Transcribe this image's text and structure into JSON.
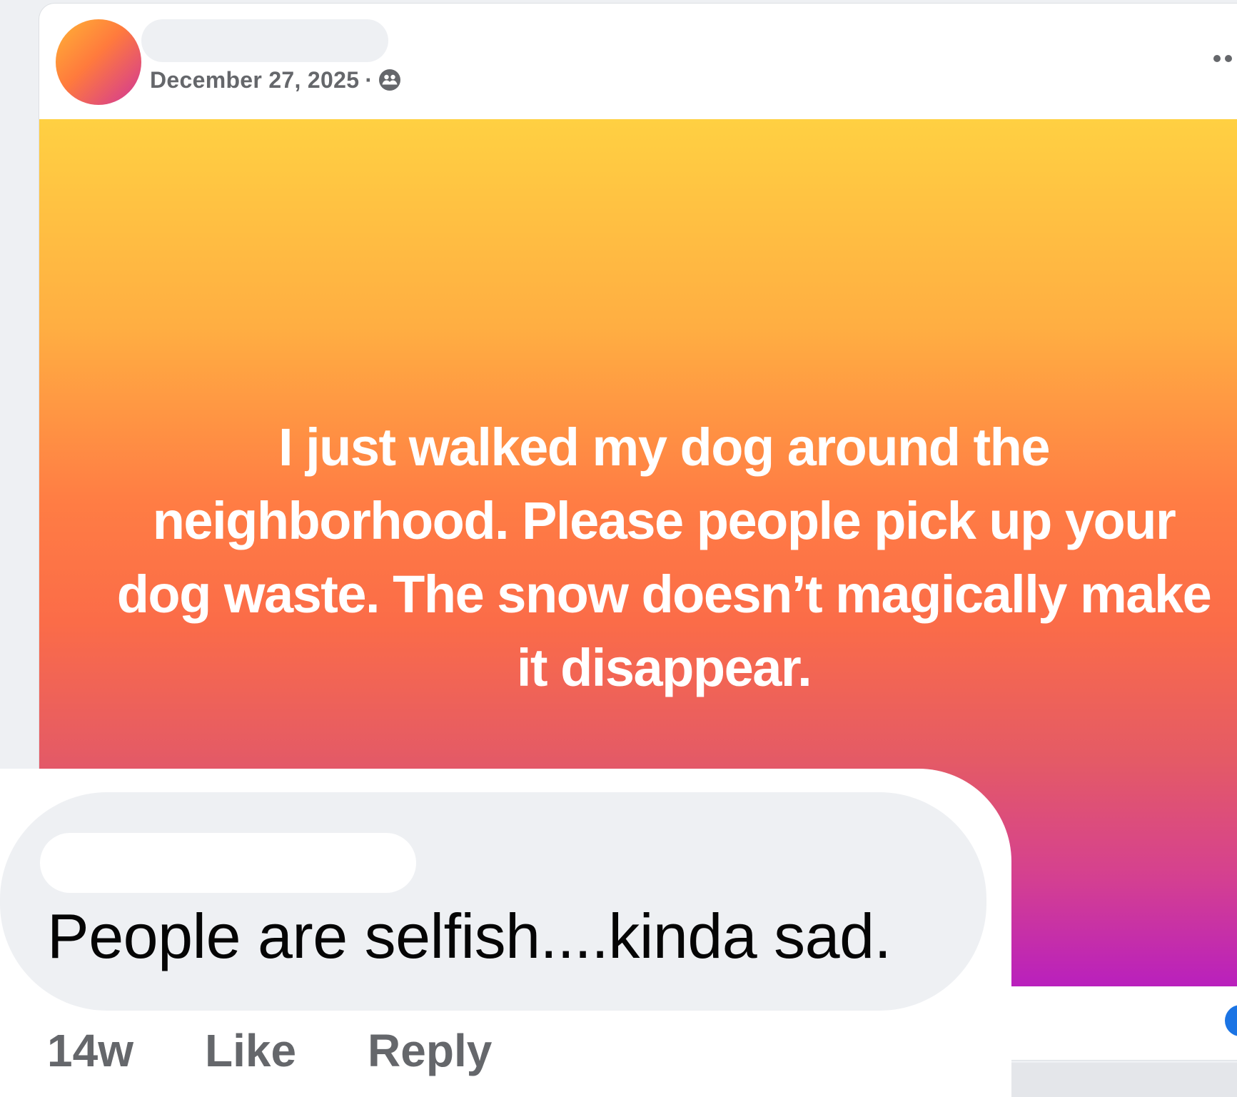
{
  "post": {
    "date": "December 27, 2025",
    "separator": "·",
    "audience_icon": "friends-icon",
    "more_icon": "more-dots-icon",
    "text": "I just walked my dog around the neighborhood. Please people pick up your dog waste. The snow doesn’t magically make it disappear.",
    "background_gradient": [
      "#ffd042",
      "#ff7d44",
      "#b920bd"
    ]
  },
  "comment": {
    "text": "People are selfish....kinda sad.",
    "time": "14w",
    "like_label": "Like",
    "reply_label": "Reply"
  },
  "colors": {
    "meta_text": "#65676b",
    "bubble": "#eef0f3",
    "accent": "#1b74e4"
  }
}
